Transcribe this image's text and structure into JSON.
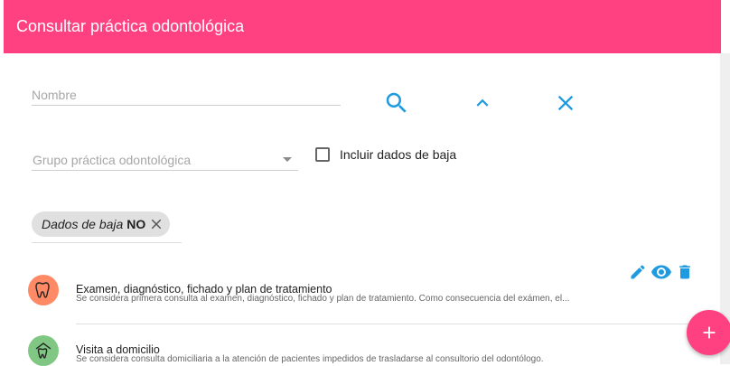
{
  "header": {
    "title": "Consultar práctica odontológica"
  },
  "search": {
    "nombre_placeholder": "Nombre",
    "grupo_placeholder": "Grupo práctica odontológica",
    "incluir_baja_label": "Incluir dados de baja",
    "incluir_baja_checked": false
  },
  "filters": {
    "chip_label": "Dados de baja",
    "chip_value": "NO"
  },
  "colors": {
    "primary": "#ff4081",
    "icon_blue": "#1e9be0"
  },
  "items": [
    {
      "title": "Examen, diagnóstico, fichado y plan de tratamiento",
      "description": "Se considera primera consulta al examen, diagnóstico, fichado y plan de tratamiento. Como consecuencia del exámen, el...",
      "icon": "tooth-icon",
      "avatar_color": "#ff8a65"
    },
    {
      "title": "Visita a domicilio",
      "description": "Se considera consulta domiciliaria a la atención de pacientes impedidos de trasladarse al consultorio del odontólogo.",
      "icon": "tooth-house-icon",
      "avatar_color": "#81c784"
    }
  ]
}
